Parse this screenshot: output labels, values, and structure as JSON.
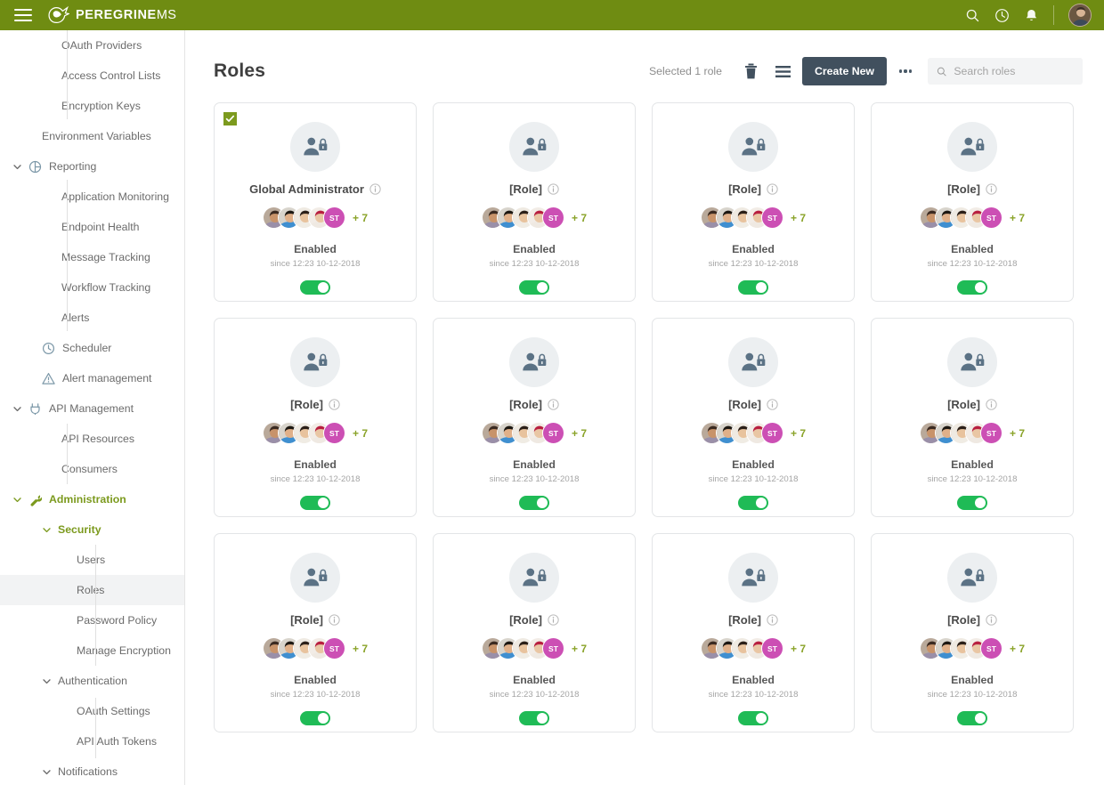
{
  "topbar": {
    "menu_icon": "hamburger-icon",
    "brand": "PEREGRINE",
    "brand_suffix": "MS",
    "icons": [
      "search-icon",
      "history-clock-icon",
      "notifications-bell-icon"
    ],
    "accent_color": "#6f8c12"
  },
  "sidebar": {
    "items": [
      {
        "label": "OAuth Providers",
        "level": 2,
        "icon": null,
        "expandable": false,
        "active": false,
        "green": false
      },
      {
        "label": "Access Control Lists",
        "level": 2,
        "icon": null,
        "expandable": false,
        "active": false,
        "green": false
      },
      {
        "label": "Encryption Keys",
        "level": 2,
        "icon": null,
        "expandable": false,
        "active": false,
        "green": false
      },
      {
        "label": "Environment Variables",
        "level": 1,
        "icon": null,
        "expandable": false,
        "active": false,
        "green": false
      },
      {
        "label": "Reporting",
        "level": 0,
        "icon": "pie-chart-icon",
        "expandable": true,
        "active": false,
        "green": false
      },
      {
        "label": "Application Monitoring",
        "level": 2,
        "icon": null,
        "expandable": false,
        "active": false,
        "green": false
      },
      {
        "label": "Endpoint Health",
        "level": 2,
        "icon": null,
        "expandable": false,
        "active": false,
        "green": false
      },
      {
        "label": "Message Tracking",
        "level": 2,
        "icon": null,
        "expandable": false,
        "active": false,
        "green": false
      },
      {
        "label": "Workflow Tracking",
        "level": 2,
        "icon": null,
        "expandable": false,
        "active": false,
        "green": false
      },
      {
        "label": "Alerts",
        "level": 2,
        "icon": null,
        "expandable": false,
        "active": false,
        "green": false
      },
      {
        "label": "Scheduler",
        "level": 1,
        "icon": "clock-icon",
        "expandable": false,
        "active": false,
        "green": false
      },
      {
        "label": "Alert management",
        "level": 1,
        "icon": "warning-triangle-icon",
        "expandable": false,
        "active": false,
        "green": false
      },
      {
        "label": "API Management",
        "level": 0,
        "icon": "plug-icon",
        "expandable": true,
        "active": false,
        "green": false
      },
      {
        "label": "API Resources",
        "level": 2,
        "icon": null,
        "expandable": false,
        "active": false,
        "green": false
      },
      {
        "label": "Consumers",
        "level": 2,
        "icon": null,
        "expandable": false,
        "active": false,
        "green": false
      },
      {
        "label": "Administration",
        "level": 0,
        "icon": "wrench-icon",
        "expandable": true,
        "active": false,
        "green": true
      },
      {
        "label": "Security",
        "level": 1,
        "icon": null,
        "expandable": true,
        "active": false,
        "green": true
      },
      {
        "label": "Users",
        "level": 3,
        "icon": null,
        "expandable": false,
        "active": false,
        "green": false
      },
      {
        "label": "Roles",
        "level": 3,
        "icon": null,
        "expandable": false,
        "active": true,
        "green": false
      },
      {
        "label": "Password Policy",
        "level": 3,
        "icon": null,
        "expandable": false,
        "active": false,
        "green": false
      },
      {
        "label": "Manage Encryption",
        "level": 3,
        "icon": null,
        "expandable": false,
        "active": false,
        "green": false
      },
      {
        "label": "Authentication",
        "level": 1,
        "icon": null,
        "expandable": true,
        "active": false,
        "green": false
      },
      {
        "label": "OAuth Settings",
        "level": 3,
        "icon": null,
        "expandable": false,
        "active": false,
        "green": false
      },
      {
        "label": "API Auth Tokens",
        "level": 3,
        "icon": null,
        "expandable": false,
        "active": false,
        "green": false
      },
      {
        "label": "Notifications",
        "level": 1,
        "icon": null,
        "expandable": true,
        "active": false,
        "green": false
      }
    ]
  },
  "page": {
    "title": "Roles",
    "selected_text": "Selected 1 role",
    "delete_icon": "trash-icon",
    "list_icon": "list-view-icon",
    "create_label": "Create New",
    "more_icon": "ellipsis-icon",
    "search_placeholder": "Search roles",
    "search_value": "",
    "search_icon": "search-icon"
  },
  "cards": [
    {
      "title": "Global Administrator",
      "selected": true,
      "status": "Enabled",
      "since": "since 12:23 10-12-2018",
      "enabled": true,
      "overflow": "+ 7",
      "initials": "ST"
    },
    {
      "title": "[Role]",
      "selected": false,
      "status": "Enabled",
      "since": "since 12:23 10-12-2018",
      "enabled": true,
      "overflow": "+ 7",
      "initials": "ST"
    },
    {
      "title": "[Role]",
      "selected": false,
      "status": "Enabled",
      "since": "since 12:23 10-12-2018",
      "enabled": true,
      "overflow": "+ 7",
      "initials": "ST"
    },
    {
      "title": "[Role]",
      "selected": false,
      "status": "Enabled",
      "since": "since 12:23 10-12-2018",
      "enabled": true,
      "overflow": "+ 7",
      "initials": "ST"
    },
    {
      "title": "[Role]",
      "selected": false,
      "status": "Enabled",
      "since": "since 12:23 10-12-2018",
      "enabled": true,
      "overflow": "+ 7",
      "initials": "ST"
    },
    {
      "title": "[Role]",
      "selected": false,
      "status": "Enabled",
      "since": "since 12:23 10-12-2018",
      "enabled": true,
      "overflow": "+ 7",
      "initials": "ST"
    },
    {
      "title": "[Role]",
      "selected": false,
      "status": "Enabled",
      "since": "since 12:23 10-12-2018",
      "enabled": true,
      "overflow": "+ 7",
      "initials": "ST"
    },
    {
      "title": "[Role]",
      "selected": false,
      "status": "Enabled",
      "since": "since 12:23 10-12-2018",
      "enabled": true,
      "overflow": "+ 7",
      "initials": "ST"
    },
    {
      "title": "[Role]",
      "selected": false,
      "status": "Enabled",
      "since": "since 12:23 10-12-2018",
      "enabled": true,
      "overflow": "+ 7",
      "initials": "ST"
    },
    {
      "title": "[Role]",
      "selected": false,
      "status": "Enabled",
      "since": "since 12:23 10-12-2018",
      "enabled": true,
      "overflow": "+ 7",
      "initials": "ST"
    },
    {
      "title": "[Role]",
      "selected": false,
      "status": "Enabled",
      "since": "since 12:23 10-12-2018",
      "enabled": true,
      "overflow": "+ 7",
      "initials": "ST"
    },
    {
      "title": "[Role]",
      "selected": false,
      "status": "Enabled",
      "since": "since 12:23 10-12-2018",
      "enabled": true,
      "overflow": "+ 7",
      "initials": "ST"
    }
  ],
  "colors": {
    "brand_green": "#6f8c12",
    "accent_olive": "#7c9a1e",
    "toggle_green": "#1fbb56",
    "button_dark": "#41505e",
    "avatar_initials_bg": "#cc4fb4"
  }
}
